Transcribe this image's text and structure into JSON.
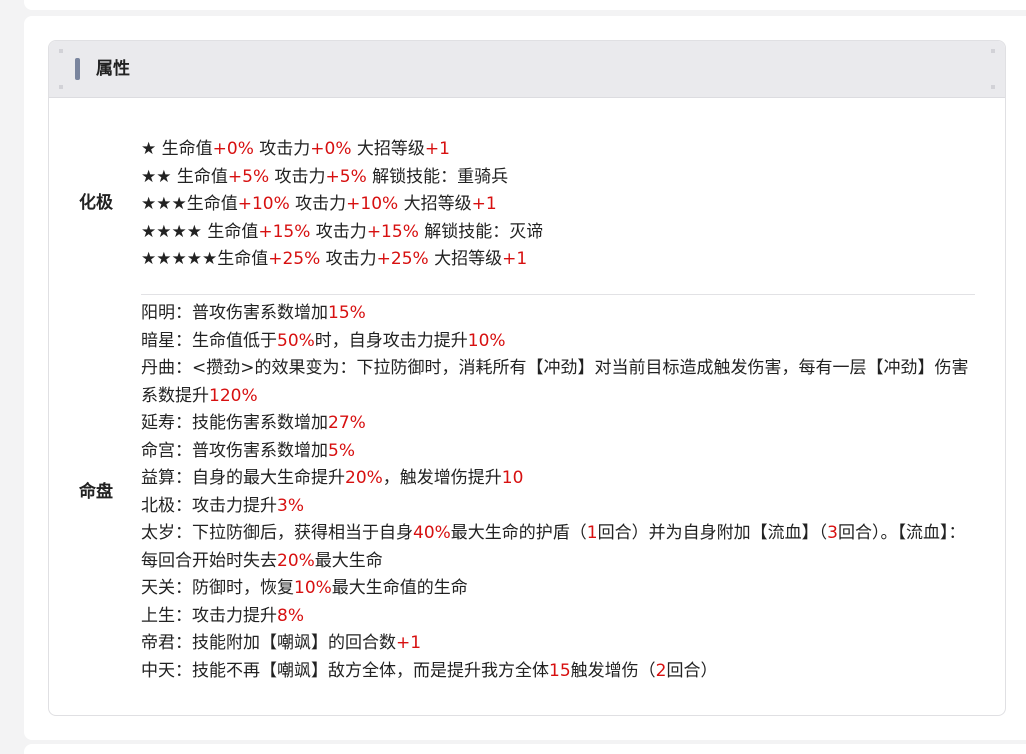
{
  "card": {
    "title": "属性"
  },
  "colors": {
    "accent": "#7a859e",
    "highlight": "#d71010",
    "text": "#222222"
  },
  "sections": [
    {
      "label": "化极",
      "lines": [
        [
          {
            "t": "★ 生命值"
          },
          {
            "t": "+0%",
            "red": true
          },
          {
            "t": " 攻击力"
          },
          {
            "t": "+0%",
            "red": true
          },
          {
            "t": " 大招等级"
          },
          {
            "t": "+1",
            "red": true
          }
        ],
        [
          {
            "t": "★★ 生命值"
          },
          {
            "t": "+5%",
            "red": true
          },
          {
            "t": " 攻击力"
          },
          {
            "t": "+5%",
            "red": true
          },
          {
            "t": " 解锁技能：重骑兵"
          }
        ],
        [
          {
            "t": "★★★生命值"
          },
          {
            "t": "+10%",
            "red": true
          },
          {
            "t": " 攻击力"
          },
          {
            "t": "+10%",
            "red": true
          },
          {
            "t": " 大招等级"
          },
          {
            "t": "+1",
            "red": true
          }
        ],
        [
          {
            "t": "★★★★ 生命值"
          },
          {
            "t": "+15%",
            "red": true
          },
          {
            "t": " 攻击力"
          },
          {
            "t": "+15%",
            "red": true
          },
          {
            "t": " 解锁技能：灭谛"
          }
        ],
        [
          {
            "t": "★★★★★生命值"
          },
          {
            "t": "+25%",
            "red": true
          },
          {
            "t": " 攻击力"
          },
          {
            "t": "+25%",
            "red": true
          },
          {
            "t": " 大招等级"
          },
          {
            "t": "+1",
            "red": true
          }
        ]
      ]
    },
    {
      "label": "命盘",
      "lines": [
        [
          {
            "t": "阳明：普攻伤害系数增加"
          },
          {
            "t": "15%",
            "red": true
          }
        ],
        [
          {
            "t": "暗星：生命值低于"
          },
          {
            "t": "50%",
            "red": true
          },
          {
            "t": "时，自身攻击力提升"
          },
          {
            "t": "10%",
            "red": true
          }
        ],
        [
          {
            "t": "丹曲：<攒劲>的效果变为：下拉防御时，消耗所有【冲劲】对当前目标造成触发伤害，每有一层【冲劲】伤害系数提升"
          },
          {
            "t": "120%",
            "red": true
          }
        ],
        [
          {
            "t": "延寿：技能伤害系数增加"
          },
          {
            "t": "27%",
            "red": true
          }
        ],
        [
          {
            "t": "命宫：普攻伤害系数增加"
          },
          {
            "t": "5%",
            "red": true
          }
        ],
        [
          {
            "t": "益算：自身的最大生命提升"
          },
          {
            "t": "20%",
            "red": true
          },
          {
            "t": "，触发增伤提升"
          },
          {
            "t": "10",
            "red": true
          }
        ],
        [
          {
            "t": "北极：攻击力提升"
          },
          {
            "t": "3%",
            "red": true
          }
        ],
        [
          {
            "t": "太岁：下拉防御后，获得相当于自身"
          },
          {
            "t": "40%",
            "red": true
          },
          {
            "t": "最大生命的护盾（"
          },
          {
            "t": "1",
            "red": true
          },
          {
            "t": "回合）并为自身附加【流血】（"
          },
          {
            "t": "3",
            "red": true
          },
          {
            "t": "回合）。【流血】：每回合开始时失去"
          },
          {
            "t": "20%",
            "red": true
          },
          {
            "t": "最大生命"
          }
        ],
        [
          {
            "t": "天关：防御时，恢复"
          },
          {
            "t": "10%",
            "red": true
          },
          {
            "t": "最大生命值的生命"
          }
        ],
        [
          {
            "t": "上生：攻击力提升"
          },
          {
            "t": "8%",
            "red": true
          }
        ],
        [
          {
            "t": "帝君：技能附加【嘲飒】的回合数"
          },
          {
            "t": "+1",
            "red": true
          }
        ],
        [
          {
            "t": "中天：技能不再【嘲飒】敌方全体，而是提升我方全体"
          },
          {
            "t": "15",
            "red": true
          },
          {
            "t": "触发增伤（"
          },
          {
            "t": "2",
            "red": true
          },
          {
            "t": "回合）"
          }
        ]
      ]
    }
  ]
}
